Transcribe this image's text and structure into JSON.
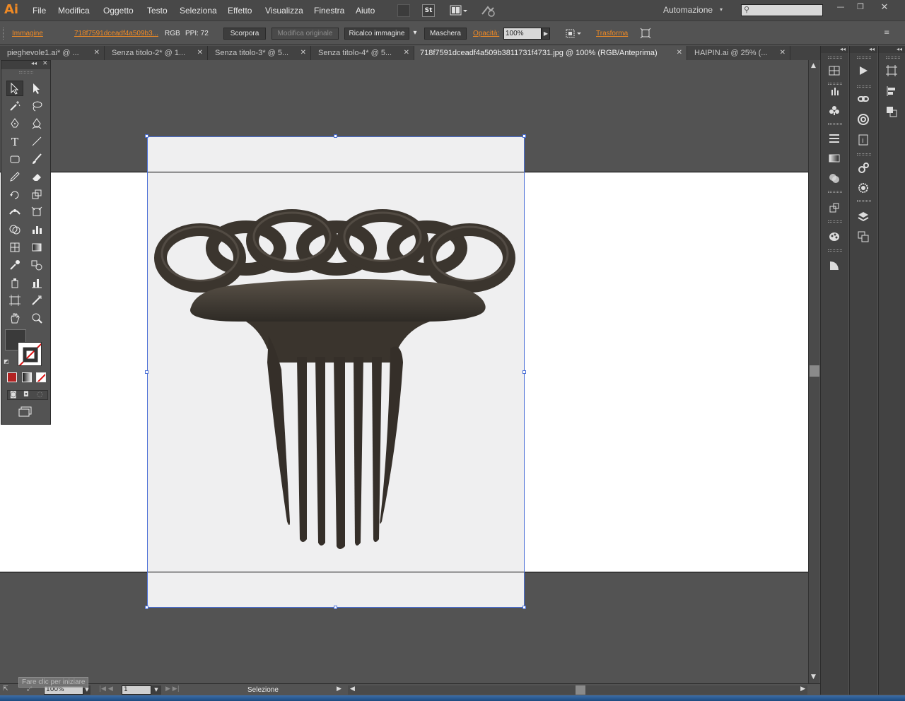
{
  "app": {
    "logo": "Ai"
  },
  "menu": [
    "File",
    "Modifica",
    "Oggetto",
    "Testo",
    "Seleziona",
    "Effetto",
    "Visualizza",
    "Finestra",
    "Aiuto"
  ],
  "menubar_icon": "St",
  "workspace": {
    "label": "Automazione"
  },
  "control": {
    "object_type": "Immagine",
    "file_link": "718f7591dceadf4a509b3...",
    "color_mode": "RGB",
    "ppi": "PPI: 72",
    "buttons": {
      "scopora": "Scorpora",
      "modifica": "Modifica originale",
      "ricalco": "Ricalco immagine",
      "maschera": "Maschera"
    },
    "opacity_label": "Opacità:",
    "opacity_value": "100%",
    "trasforma": "Trasforma"
  },
  "tabs": [
    {
      "label": "pieghevole1.ai* @ ...",
      "active": false
    },
    {
      "label": "Senza titolo-2* @ 1...",
      "active": false
    },
    {
      "label": "Senza titolo-3* @ 5...",
      "active": false
    },
    {
      "label": "Senza titolo-4* @ 5...",
      "active": false
    },
    {
      "label": "718f7591dceadf4a509b3811731f4731.jpg @ 100% (RGB/Anteprima)",
      "active": true
    },
    {
      "label": "HAIPIN.ai @ 25% (...",
      "active": false
    }
  ],
  "status": {
    "zoom": "100%",
    "page": "1",
    "tool": "Selezione",
    "tooltip": "Fare clic per iniziare"
  },
  "colors": {
    "accent": "#f08a24",
    "selection": "#4a6fd6",
    "stroke_swatch": "#b22222"
  }
}
